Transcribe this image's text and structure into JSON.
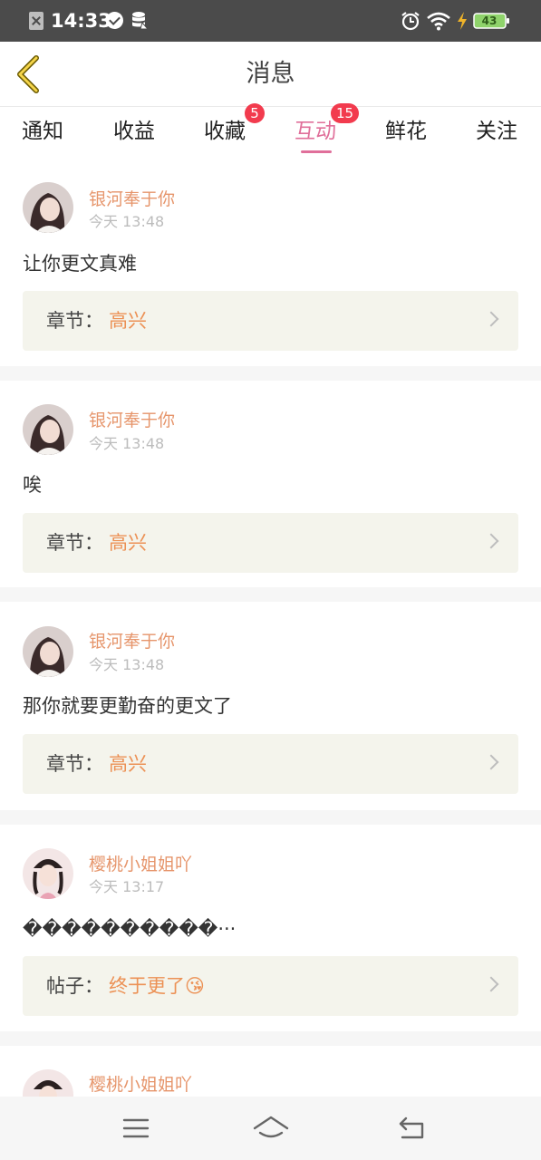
{
  "status_bar": {
    "time": "14:33",
    "battery": "43",
    "icons": [
      "notification-x-icon",
      "check-circle-icon",
      "data-icon",
      "alarm-icon",
      "wifi-icon",
      "charging-bolt-icon",
      "battery-icon"
    ]
  },
  "header": {
    "title": "消息",
    "back_icon": "chevron-left-icon"
  },
  "tabs": [
    {
      "label": "通知"
    },
    {
      "label": "收益"
    },
    {
      "label": "收藏",
      "badge": "5"
    },
    {
      "label": "互动",
      "badge": "15",
      "active": true
    },
    {
      "label": "鲜花"
    },
    {
      "label": "关注"
    }
  ],
  "colors": {
    "accent": "#e06f9a",
    "badge": "#f23b4e",
    "username": "#e6956b",
    "ref_value": "#ec9155",
    "ref_bg": "#f4f4ec"
  },
  "items": [
    {
      "name": "银河奉于你",
      "time": "今天 13:48",
      "text": "让你更文真难",
      "ref_label": "章节：",
      "ref_value": "高兴"
    },
    {
      "name": "银河奉于你",
      "time": "今天 13:48",
      "text": "唉",
      "ref_label": "章节：",
      "ref_value": "高兴"
    },
    {
      "name": "银河奉于你",
      "time": "今天 13:48",
      "text": "那你就要更勤奋的更文了",
      "ref_label": "章节：",
      "ref_value": "高兴"
    },
    {
      "name": "樱桃小姐姐吖",
      "time": "今天 13:17",
      "text": "����������···",
      "ref_label": "帖子：",
      "ref_value": "终于更了😘"
    },
    {
      "name": "樱桃小姐姐吖"
    }
  ],
  "bottom_nav": {
    "icons": [
      "menu-icon",
      "home-icon",
      "back-icon"
    ]
  }
}
